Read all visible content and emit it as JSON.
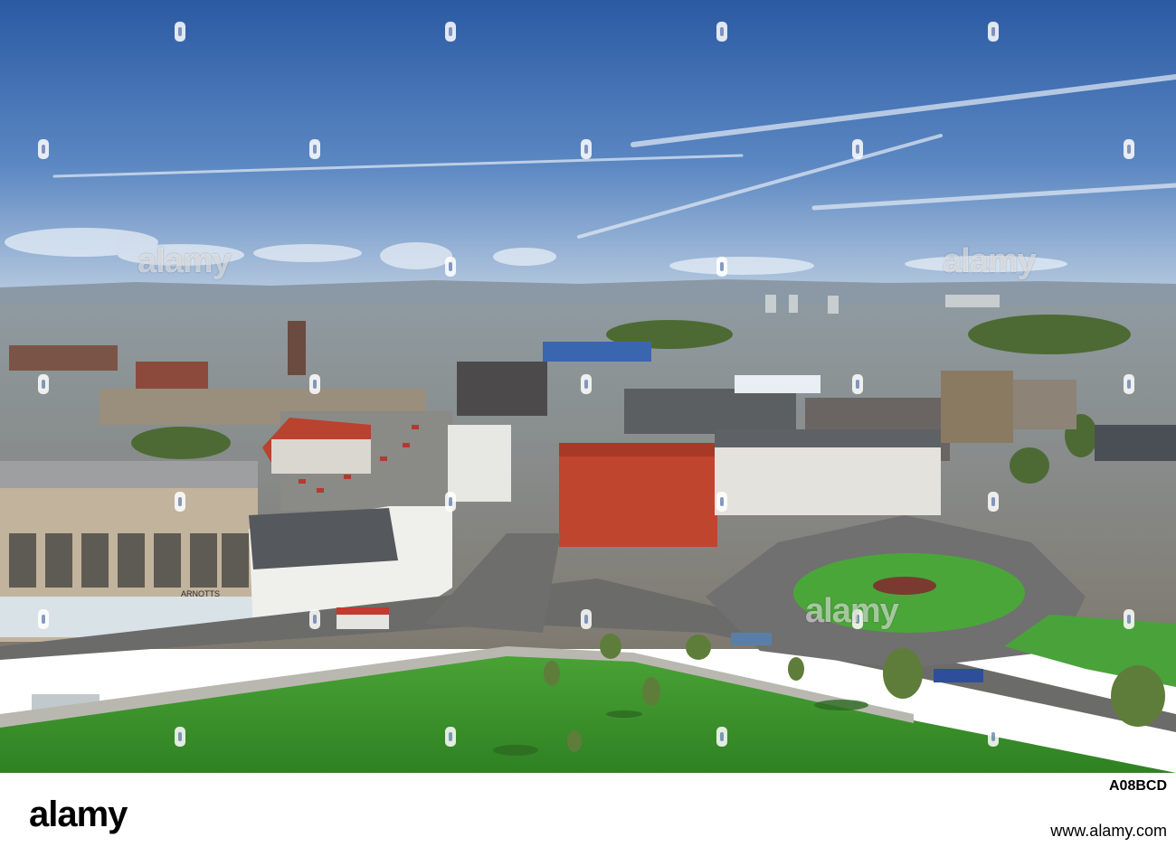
{
  "photo": {
    "watermark_text": "alamy",
    "mark_icon": "alamy-a-icon",
    "store_sign_text": "ARNOTTS"
  },
  "footer": {
    "logo_text": "alamy",
    "image_id": "A08BCD",
    "url": "www.alamy.com"
  },
  "colors": {
    "sky_top": "#2f5ea6",
    "sky_horizon": "#b7cbe0",
    "grass": "#3f9a2c",
    "red_building": "#c0452e",
    "road": "#6e6e6c"
  }
}
